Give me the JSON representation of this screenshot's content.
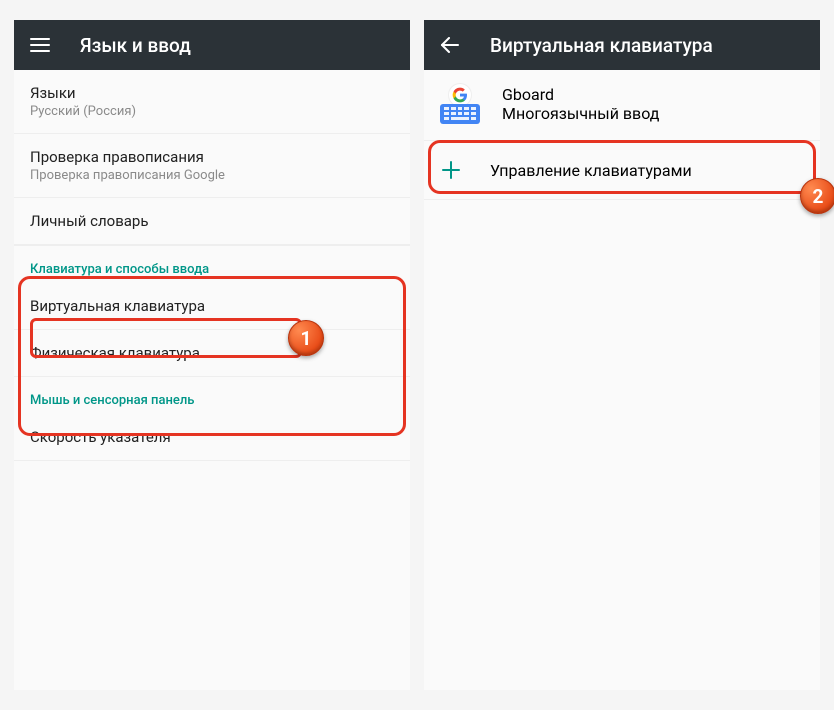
{
  "left": {
    "title": "Язык и ввод",
    "languages": {
      "label": "Языки",
      "value": "Русский (Россия)"
    },
    "spellcheck": {
      "label": "Проверка правописания",
      "value": "Проверка правописания Google"
    },
    "personal_dict": {
      "label": "Личный словарь"
    },
    "section_keyboard": "Клавиатура и способы ввода",
    "virtual_keyboard": {
      "label": "Виртуальная клавиатура"
    },
    "physical_keyboard": {
      "label": "Физическая клавиатура"
    },
    "section_mouse": "Мышь и сенсорная панель",
    "pointer_speed": {
      "label": "Скорость указателя"
    }
  },
  "right": {
    "title": "Виртуальная клавиатура",
    "gboard": {
      "title": "Gboard",
      "subtitle": "Многоязычный ввод"
    },
    "manage": {
      "label": "Управление клавиатурами"
    }
  },
  "badges": {
    "one": "1",
    "two": "2"
  }
}
